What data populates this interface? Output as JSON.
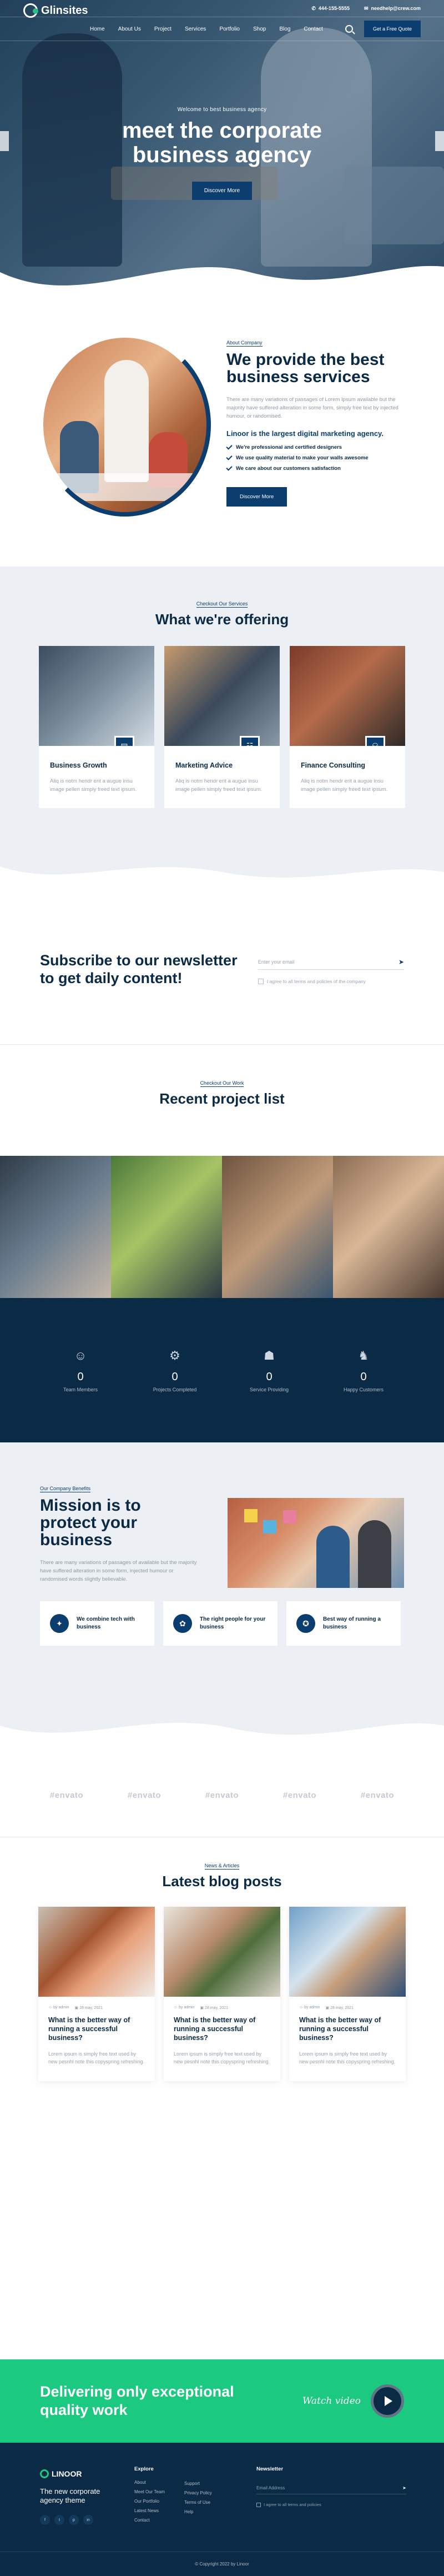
{
  "header": {
    "logo": "Glinsites",
    "phone": "444-155-5555",
    "email": "needhelp@crew.com",
    "menu": [
      "Home",
      "About Us",
      "Project",
      "Services",
      "Portfolio",
      "Shop",
      "Blog",
      "Contact"
    ],
    "quote_button": "Get a Free Quote"
  },
  "hero": {
    "kicker": "Welcome to best business agency",
    "title_line1": "meet the corporate",
    "title_line2": "business agency",
    "button": "Discover More"
  },
  "about": {
    "kicker": "About Company",
    "title": "We provide the best business services",
    "text": "There are many variations of passages of Lorem Ipsum available but the majority have suffered alteration in some form, simply free text by injected humour, or randomised.",
    "lead": "Linoor is the largest digital marketing agency.",
    "checks": [
      "We're professional and certified designers",
      "We use quality material to make your walls awesome",
      "We care about our customers satisfaction"
    ],
    "button": "Discover More"
  },
  "services": {
    "kicker": "Checkout Our Services",
    "title": "What we're offering",
    "cards": [
      {
        "title": "Business Growth",
        "text": "Aliq is notm hendr erit a augue insu image pellen simply freed text ipsum."
      },
      {
        "title": "Marketing Advice",
        "text": "Aliq is notm hendr erit a augue insu image pellen simply freed text ipsum."
      },
      {
        "title": "Finance Consulting",
        "text": "Aliq is notm hendr erit a augue insu image pellen simply freed text ipsum."
      }
    ]
  },
  "newsletter": {
    "title": "Subscribe to our newsletter to get daily content!",
    "placeholder": "Enter your email",
    "agree": "I agree to all terms and policies of the company"
  },
  "projects": {
    "kicker": "Checkout Our Work",
    "title": "Recent project list"
  },
  "stats": [
    {
      "icon": "team-icon",
      "num": "0",
      "label": "Team Members"
    },
    {
      "icon": "project-icon",
      "num": "0",
      "label": "Projects Completed"
    },
    {
      "icon": "service-icon",
      "num": "0",
      "label": "Service Providing"
    },
    {
      "icon": "customer-icon",
      "num": "0",
      "label": "Happy Customers"
    }
  ],
  "mission": {
    "kicker": "Our Company Benefits",
    "title": "Mission is to protect your business",
    "text": "There are many variations of passages of available but the majority have suffered alteration in some form, injected humour or randomised words slightly believable.",
    "cards": [
      "We combine tech with business",
      "The right people for your business",
      "Best way of running a business"
    ]
  },
  "brands": [
    "envato",
    "envato",
    "envato",
    "envato",
    "envato"
  ],
  "blog": {
    "kicker": "News & Articles",
    "title": "Latest blog posts",
    "posts": [
      {
        "author": "by admin",
        "date": "28 may, 2021",
        "title": "What is the better way of running a successful business?",
        "text": "Lorem ipsum is simply free text used by new pesnhl note this copyspring refreshing."
      },
      {
        "author": "by admin",
        "date": "28 may, 2021",
        "title": "What is the better way of running a successful business?",
        "text": "Lorem ipsum is simply free text used by new pesnhl note this copyspring refreshing."
      },
      {
        "author": "by admin",
        "date": "28 may, 2021",
        "title": "What is the better way of running a successful business?",
        "text": "Lorem ipsum is simply free text used by new pesnhl note this copyspring refreshing."
      }
    ]
  },
  "cta": {
    "title": "Delivering only exceptional quality work",
    "watch": "Watch video"
  },
  "footer": {
    "logo": "LINOOR",
    "tagline": "The new corporate agency theme",
    "social": [
      "f",
      "t",
      "p",
      "in"
    ],
    "explore_heading": "Explore",
    "explore": [
      "About",
      "Meet Our Team",
      "Our Portfolio",
      "Latest News",
      "Contact"
    ],
    "links": [
      "Support",
      "Privacy Policy",
      "Terms of Use",
      "Help"
    ],
    "newsletter_heading": "Newsletter",
    "email_placeholder": "Email Address",
    "agree": "I agree to all terms and policies",
    "copyright": "© Copyright 2022 by Linoor"
  }
}
